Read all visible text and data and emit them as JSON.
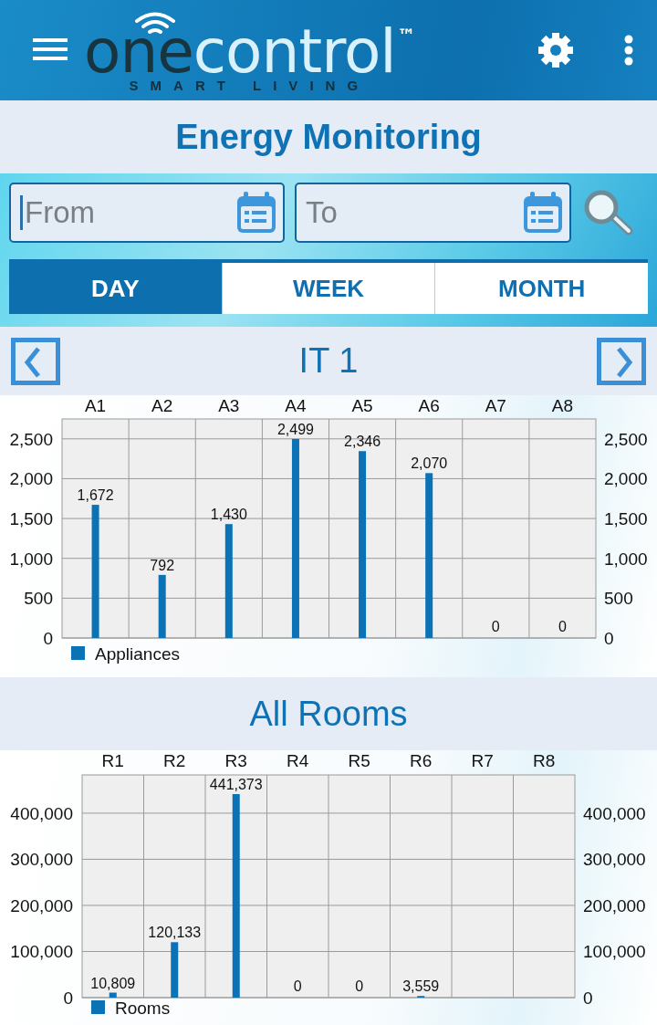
{
  "header": {
    "logo": {
      "word_1": "one",
      "word_2": "control",
      "mark": "™",
      "tagline": "SMART LIVING"
    }
  },
  "title": "Energy Monitoring",
  "filters": {
    "from": {
      "placeholder": "From"
    },
    "to": {
      "placeholder": "To"
    }
  },
  "tabs": [
    {
      "label": "DAY",
      "selected": true
    },
    {
      "label": "WEEK",
      "selected": false
    },
    {
      "label": "MONTH",
      "selected": false
    }
  ],
  "sections": [
    {
      "title": "IT 1",
      "nav": true,
      "chart_data": {
        "type": "bar",
        "categories": [
          "A1",
          "A2",
          "A3",
          "A4",
          "A5",
          "A6",
          "A7",
          "A8"
        ],
        "series": [
          {
            "name": "Appliances",
            "color": "#0b72b5",
            "values": [
              1672,
              792,
              1430,
              2499,
              2346,
              2070,
              0,
              0
            ]
          }
        ],
        "value_labels": [
          "1,672",
          "792",
          "1,430",
          "2,499",
          "2,346",
          "2,070",
          "0",
          "0"
        ],
        "ylim": [
          0,
          2750
        ],
        "y2lim": [
          0,
          2750
        ],
        "grid": true,
        "yticks": [
          {
            "value": 0,
            "label": "0"
          },
          {
            "value": 500,
            "label": "500"
          },
          {
            "value": 1000,
            "label": "1,000"
          },
          {
            "value": 1500,
            "label": "1,500"
          },
          {
            "value": 2000,
            "label": "2,000"
          },
          {
            "value": 2500,
            "label": "2,500"
          }
        ],
        "y2ticks": [
          {
            "value": 0,
            "label": "0"
          },
          {
            "value": 500,
            "label": "500"
          },
          {
            "value": 1000,
            "label": "1,000"
          },
          {
            "value": 1500,
            "label": "1,500"
          },
          {
            "value": 2000,
            "label": "2,000"
          },
          {
            "value": 2500,
            "label": "2,500"
          }
        ]
      }
    },
    {
      "title": "All Rooms",
      "nav": false,
      "chart_data": {
        "type": "bar",
        "categories": [
          "R1",
          "R2",
          "R3",
          "R4",
          "R5",
          "R6",
          "R7",
          "R8"
        ],
        "series": [
          {
            "name": "Rooms",
            "color": "#0b72b5",
            "values": [
              10809,
              120133,
              441373,
              0,
              0,
              3559,
              null,
              null
            ]
          }
        ],
        "value_labels": [
          "10,809",
          "120,133",
          "441,373",
          "0",
          "0",
          "3,559",
          null,
          null
        ],
        "ylim": [
          0,
          483000
        ],
        "y2lim": [
          0,
          483000
        ],
        "grid": true,
        "yticks": [
          {
            "value": 0,
            "label": "0"
          },
          {
            "value": 100000,
            "label": "100,000"
          },
          {
            "value": 200000,
            "label": "200,000"
          },
          {
            "value": 300000,
            "label": "300,000"
          },
          {
            "value": 400000,
            "label": "400,000"
          }
        ],
        "y2ticks": [
          {
            "value": 0,
            "label": "0"
          },
          {
            "value": 100000,
            "label": "100,000"
          },
          {
            "value": 200000,
            "label": "200,000"
          },
          {
            "value": 300000,
            "label": "300,000"
          },
          {
            "value": 400000,
            "label": "400,000"
          }
        ]
      }
    }
  ]
}
